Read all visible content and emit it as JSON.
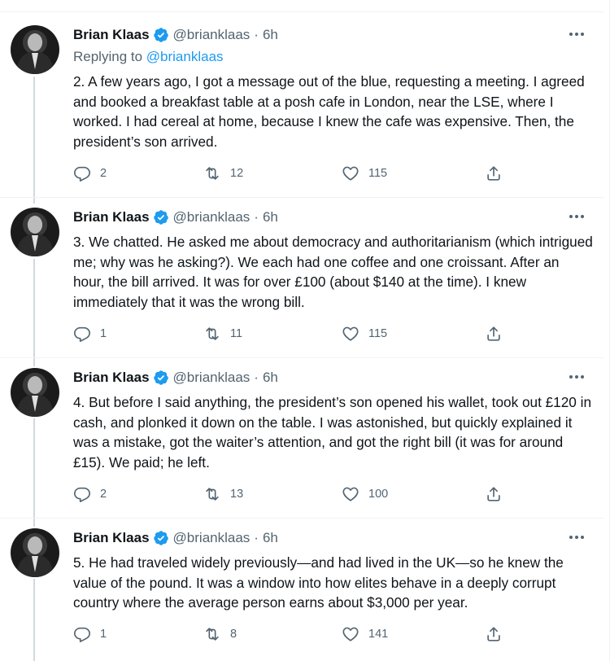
{
  "colors": {
    "accent": "#1d9bf0",
    "text": "#0f1419",
    "muted": "#536471",
    "line": "#cfd9de"
  },
  "icons": [
    "verified-badge-icon",
    "more-options-icon",
    "reply-icon",
    "retweet-icon",
    "like-icon",
    "share-icon"
  ],
  "tweets": [
    {
      "name": "Brian Klaas",
      "handle": "@brianklaas",
      "separator": "·",
      "time": "6h",
      "replying_prefix": "Replying to ",
      "replying_handle": "@brianklaas",
      "text": "2. A few years ago, I got a message out of the blue, requesting a meeting. I agreed and booked a breakfast table at a posh cafe in London, near the LSE, where I worked. I had cereal at home, because I knew the cafe was expensive. Then, the president’s son arrived.",
      "replies": "2",
      "retweets": "12",
      "likes": "115"
    },
    {
      "name": "Brian Klaas",
      "handle": "@brianklaas",
      "separator": "·",
      "time": "6h",
      "text": "3. We chatted. He asked me about democracy and authoritarianism (which intrigued me; why was he asking?). We each had one coffee and one croissant. After an hour, the bill arrived. It was for over £100 (about $140 at the time). I knew immediately that it was the wrong bill.",
      "replies": "1",
      "retweets": "11",
      "likes": "115"
    },
    {
      "name": "Brian Klaas",
      "handle": "@brianklaas",
      "separator": "·",
      "time": "6h",
      "text": "4. But before I said anything, the president’s son opened his wallet, took out £120 in cash, and plonked it down on the table. I was astonished, but quickly explained it was a mistake, got the waiter’s attention, and got the right bill (it was for around £15). We paid; he left.",
      "replies": "2",
      "retweets": "13",
      "likes": "100"
    },
    {
      "name": "Brian Klaas",
      "handle": "@brianklaas",
      "separator": "·",
      "time": "6h",
      "text": "5. He had traveled widely previously—and had lived in the UK—so he knew the value of the pound. It was a window into how elites behave in a deeply corrupt country where the average person earns about $3,000 per year.",
      "replies": "1",
      "retweets": "8",
      "likes": "141"
    }
  ]
}
